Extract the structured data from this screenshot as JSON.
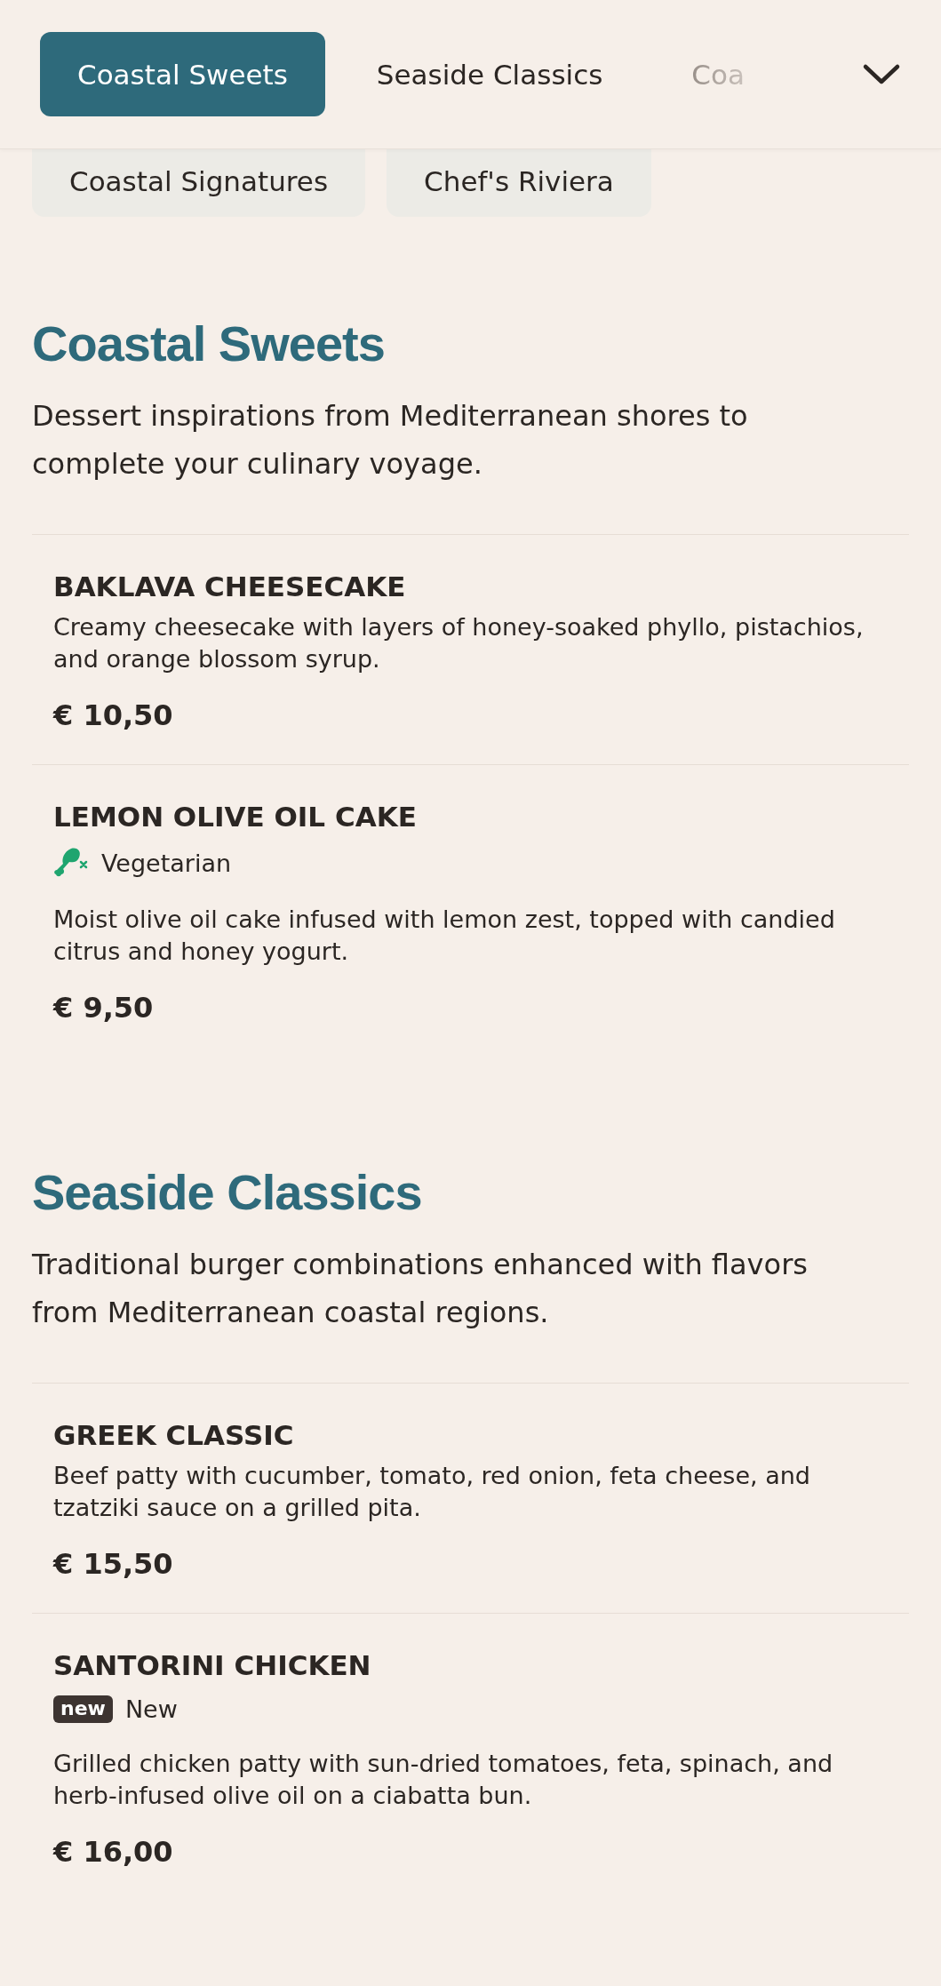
{
  "nav": {
    "tabs": [
      {
        "label": "Coastal Sweets",
        "selected": true
      },
      {
        "label": "Seaside Classics",
        "selected": false
      },
      {
        "label": "Coa",
        "selected": false
      }
    ],
    "more_tabs": [
      {
        "label": "Coastal Signatures",
        "selected": false
      },
      {
        "label": "Chef's Riviera",
        "selected": false
      }
    ]
  },
  "sections": [
    {
      "title": "Coastal Sweets",
      "description": "Dessert inspirations from Mediterranean shores to complete your culinary voyage.",
      "items": [
        {
          "name": "BAKLAVA CHEESECAKE",
          "description": "Creamy cheesecake with layers of honey-soaked phyllo, pistachios, and orange blossom syrup.",
          "price": "€ 10,50"
        },
        {
          "name": "LEMON OLIVE OIL CAKE",
          "tags": [
            {
              "kind": "vegetarian",
              "label": "Vegetarian"
            }
          ],
          "description": "Moist olive oil cake infused with lemon zest, topped with candied citrus and honey yogurt.",
          "price": "€ 9,50"
        }
      ]
    },
    {
      "title": "Seaside Classics",
      "description": "Traditional burger combinations enhanced with flavors from Mediterranean coastal regions.",
      "items": [
        {
          "name": "GREEK CLASSIC",
          "description": "Beef patty with cucumber, tomato, red onion, feta cheese, and tzatziki sauce on a grilled pita.",
          "price": "€ 15,50"
        },
        {
          "name": "SANTORINI CHICKEN",
          "tags": [
            {
              "kind": "new",
              "badge": "new",
              "label": "New"
            }
          ],
          "description": "Grilled chicken patty with sun-dried tomatoes, feta, spinach, and herb-infused olive oil on a ciabatta bun.",
          "price": "€ 16,00"
        }
      ]
    }
  ]
}
